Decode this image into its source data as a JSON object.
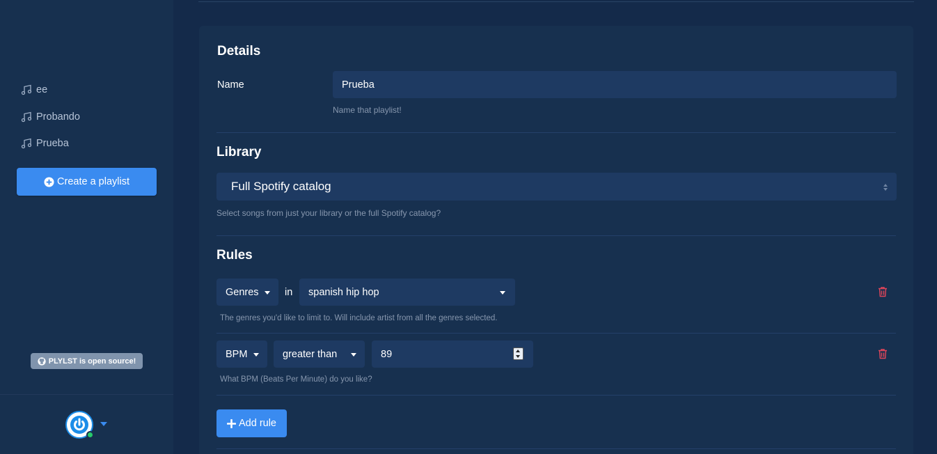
{
  "sidebar": {
    "playlists": [
      {
        "label": "ee",
        "icon": "music-note-icon"
      },
      {
        "label": "Probando",
        "icon": "music-note-icon"
      },
      {
        "label": "Prueba",
        "icon": "music-note-icon"
      }
    ],
    "create_label": "Create a playlist",
    "oss_label": "PLYLST is open source!"
  },
  "details": {
    "title": "Details",
    "name_label": "Name",
    "name_value": "Prueba",
    "name_help": "Name that playlist!"
  },
  "library": {
    "title": "Library",
    "selected": "Full Spotify catalog",
    "help": "Select songs from just your library or the full Spotify catalog?"
  },
  "rules": {
    "title": "Rules",
    "items": [
      {
        "field": "Genres",
        "operator_text": "in",
        "value": "spanish hip hop",
        "help": "The genres you'd like to limit to. Will include artist from all the genres selected."
      },
      {
        "field": "BPM",
        "operator": "greater than",
        "value": "89",
        "help": "What BPM (Beats Per Minute) do you like?"
      }
    ],
    "add_label": "Add rule"
  },
  "colors": {
    "accent": "#3a8bf0",
    "danger": "#e0455a",
    "sidebar_bg": "#17304f",
    "page_bg": "#142a4a"
  }
}
